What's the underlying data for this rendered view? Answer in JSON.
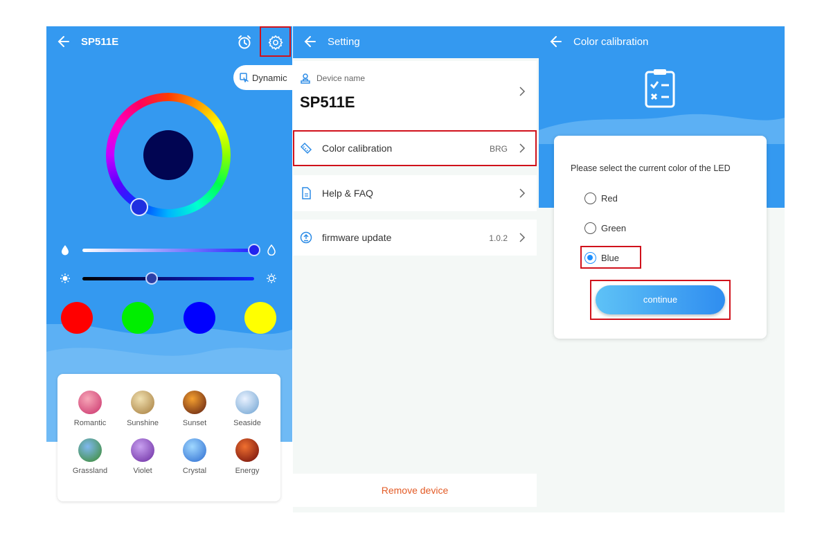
{
  "panel1": {
    "title": "SP511E",
    "dynamic_label": "Dynamic",
    "presets": [
      {
        "name": "red",
        "color": "#ff0000"
      },
      {
        "name": "green",
        "color": "#00ee00"
      },
      {
        "name": "blue",
        "color": "#0000ff"
      },
      {
        "name": "yellow",
        "color": "#ffff00"
      }
    ],
    "scenes": [
      {
        "label": "Romantic",
        "colors": [
          "#f7a7b8",
          "#c9306a"
        ]
      },
      {
        "label": "Sunshine",
        "colors": [
          "#f0e0b0",
          "#a47a3a"
        ]
      },
      {
        "label": "Sunset",
        "colors": [
          "#f5a030",
          "#5a1a10"
        ]
      },
      {
        "label": "Seaside",
        "colors": [
          "#eaf2ff",
          "#6aa0d0"
        ]
      },
      {
        "label": "Grassland",
        "colors": [
          "#7fb8f0",
          "#3a8a2a"
        ]
      },
      {
        "label": "Violet",
        "colors": [
          "#c8a0f0",
          "#6a2aa0"
        ]
      },
      {
        "label": "Crystal",
        "colors": [
          "#a0d8ff",
          "#2a6ad0"
        ]
      },
      {
        "label": "Energy",
        "colors": [
          "#f07030",
          "#6a0a0a"
        ]
      }
    ],
    "current_color": "#010552",
    "accent": "#3499f0"
  },
  "panel2": {
    "title": "Setting",
    "device_name_label": "Device name",
    "device_name": "SP511E",
    "rows": {
      "color_calibration": {
        "label": "Color calibration",
        "value": "BRG"
      },
      "help": {
        "label": "Help & FAQ",
        "value": ""
      },
      "firmware": {
        "label": "firmware update",
        "value": "1.0.2"
      }
    },
    "remove_device": "Remove device"
  },
  "panel3": {
    "title": "Color calibration",
    "prompt": "Please select the current color of the LED",
    "options": [
      {
        "label": "Red",
        "selected": false
      },
      {
        "label": "Green",
        "selected": false
      },
      {
        "label": "Blue",
        "selected": true
      }
    ],
    "continue_label": "continue"
  },
  "highlight_color": "#d0111b"
}
